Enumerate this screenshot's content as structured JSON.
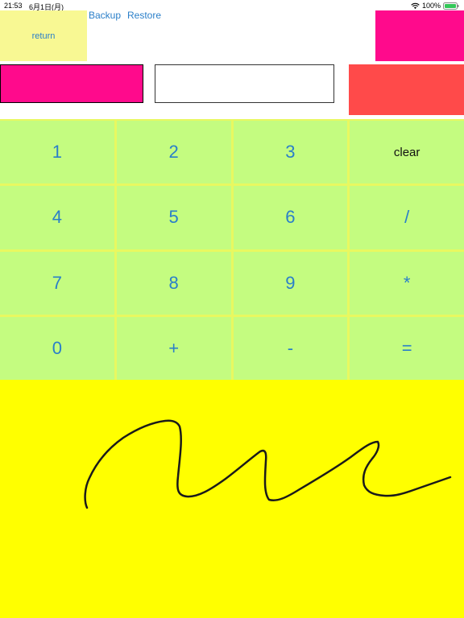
{
  "status": {
    "time": "21:53",
    "date": "6月1日(月)",
    "battery": "100%"
  },
  "toolbar": {
    "return_label": "return",
    "backup_label": "Backup",
    "restore_label": "Restore",
    "top_right_label": "",
    "red_button_label": ""
  },
  "input": {
    "value": "",
    "placeholder": ""
  },
  "keypad": {
    "keys": [
      "1",
      "2",
      "3",
      "clear",
      "4",
      "5",
      "6",
      "/",
      "7",
      "8",
      "9",
      "*",
      "0",
      "+",
      "-",
      "="
    ]
  },
  "colors": {
    "return_bg": "#f8f893",
    "pink": "#ff0a8c",
    "red_button": "#ff4a4a",
    "key_bg": "#c4fc80",
    "key_grid": "#e8f860",
    "drawing_bg": "#ffff00",
    "accent": "#2a7fc9"
  },
  "drawing": {
    "stroke_color": "#1a1a1a"
  }
}
